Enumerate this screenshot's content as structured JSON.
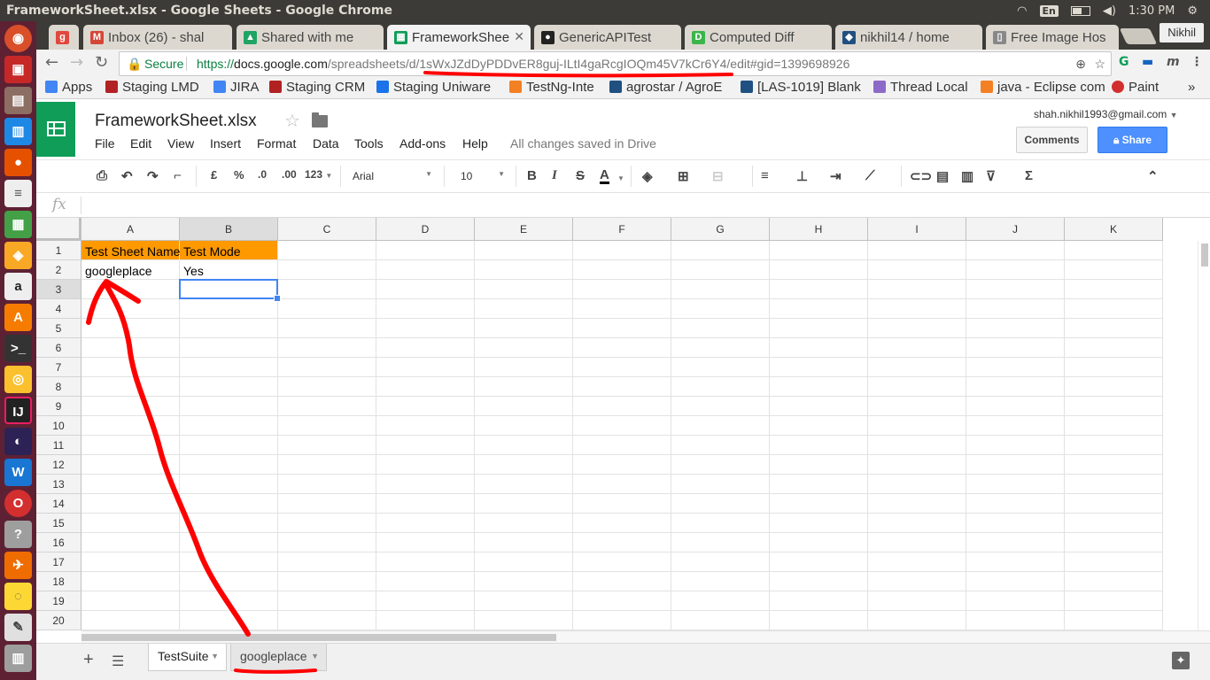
{
  "system": {
    "window_title": "FrameworkSheet.xlsx - Google Sheets - Google Chrome",
    "lang": "En",
    "time": "1:30 PM"
  },
  "browser": {
    "tabs": [
      {
        "label": "",
        "favicon_color": "#e1473d",
        "favicon_glyph": "g"
      },
      {
        "label": "Inbox (26) - shal",
        "favicon_color": "#d44638",
        "favicon_glyph": "M"
      },
      {
        "label": "Shared with me",
        "favicon_color": "#1fa463",
        "favicon_glyph": "▲"
      },
      {
        "label": "FrameworkShee",
        "favicon_color": "#0f9d58",
        "favicon_glyph": "▦"
      },
      {
        "label": "GenericAPITest",
        "favicon_color": "#222222",
        "favicon_glyph": "●"
      },
      {
        "label": "Computed Diff",
        "favicon_color": "#3bb54a",
        "favicon_glyph": "D"
      },
      {
        "label": "nikhil14 / home",
        "favicon_color": "#205081",
        "favicon_glyph": "◆"
      },
      {
        "label": "Free Image Hos",
        "favicon_color": "#888888",
        "favicon_glyph": "▯"
      }
    ],
    "profile_name": "Nikhil",
    "secure_label": "Secure",
    "url_scheme": "https://",
    "url_domain": "docs.google.com",
    "url_path": "/spreadsheets/d/1sWxJZdDyPDDvER8guj-ILtI4gaRcgIOQm45V7kCr6Y4/edit#gid=1399698926",
    "bookmarks": [
      {
        "label": "Apps",
        "color": "#4285f4"
      },
      {
        "label": "Staging LMD",
        "color": "#b22222"
      },
      {
        "label": "JIRA",
        "color": "#4285f4"
      },
      {
        "label": "Staging CRM",
        "color": "#b22222"
      },
      {
        "label": "Staging Uniware",
        "color": "#1a73e8"
      },
      {
        "label": "TestNg-Inte",
        "color": "#f48024"
      },
      {
        "label": "agrostar / AgroE",
        "color": "#205081"
      },
      {
        "label": "[LAS-1019] Blank",
        "color": "#205081"
      },
      {
        "label": "Thread Local",
        "color": "#8c6bc8"
      },
      {
        "label": "java - Eclipse com",
        "color": "#f48024"
      },
      {
        "label": "Paint",
        "color": "#d32f2f"
      }
    ]
  },
  "doc": {
    "title": "FrameworkSheet.xlsx",
    "menus": [
      "File",
      "Edit",
      "View",
      "Insert",
      "Format",
      "Data",
      "Tools",
      "Add-ons",
      "Help"
    ],
    "saved_status": "All changes saved in Drive",
    "account": "shah.nikhil1993@gmail.com",
    "comments_label": "Comments",
    "share_label": "Share"
  },
  "toolbar": {
    "currency": "£",
    "percent": "%",
    "dec_less": ".0",
    "dec_more": ".00",
    "more_formats": "123",
    "font": "Arial",
    "font_size": "10",
    "bold": "B",
    "italic": "I",
    "strike": "S",
    "text_color": "A",
    "sum": "Σ"
  },
  "formula_bar": {
    "fx": "fx",
    "value": ""
  },
  "grid": {
    "columns": [
      "A",
      "B",
      "C",
      "D",
      "E",
      "F",
      "G",
      "H",
      "I",
      "J",
      "K"
    ],
    "rows": [
      "1",
      "2",
      "3",
      "4",
      "5",
      "6",
      "7",
      "8",
      "9",
      "10",
      "11",
      "12",
      "13",
      "14",
      "15",
      "16",
      "17",
      "18",
      "19",
      "20"
    ],
    "cells": {
      "A1": "Test Sheet Name",
      "B1": "Test Mode",
      "A2": "googleplace",
      "B2": "Yes"
    },
    "header_fill": "#ff9900",
    "selected_cell": "B3"
  },
  "sheets": {
    "tabs": [
      {
        "label": "TestSuite",
        "active": true
      },
      {
        "label": "googleplace",
        "active": false
      }
    ]
  },
  "annotation": {
    "color": "#ff0000"
  }
}
